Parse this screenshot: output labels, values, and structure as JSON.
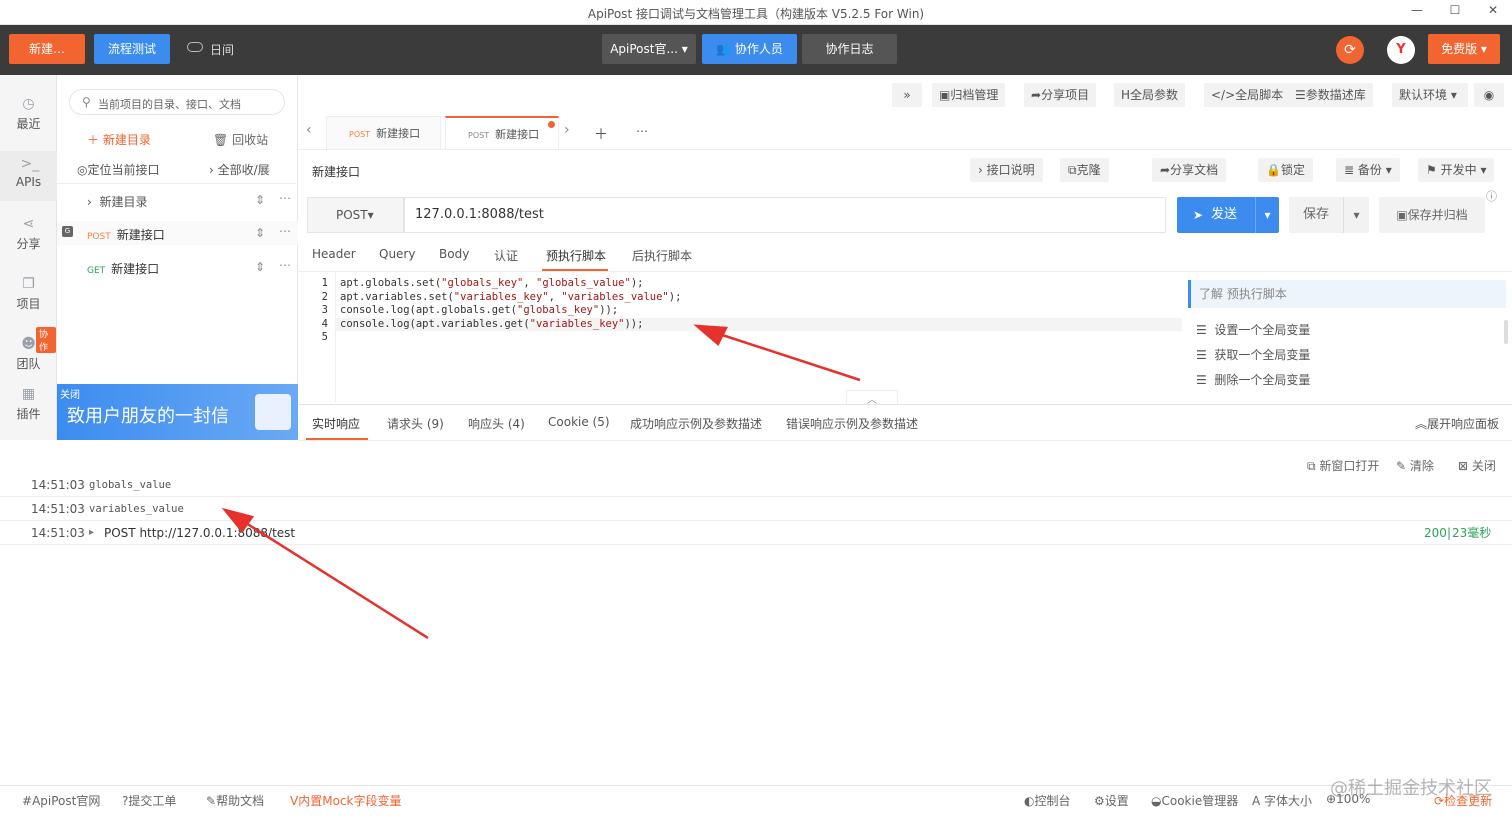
{
  "window": {
    "title": "ApiPost 接口调试与文档管理工具（构建版本 V5.2.5 For Win)",
    "min": "—",
    "max": "☐",
    "close": "✕"
  },
  "topbar": {
    "new_label": "新建…",
    "flow_label": "流程测试",
    "log_toggle": "日间",
    "project": "ApiPost官...",
    "collab": "协作人员",
    "collab_log": "协作日志",
    "plan": "免费版"
  },
  "sidebar": {
    "items": [
      {
        "label": "最近",
        "icon": "clock-icon",
        "glyph": "◷"
      },
      {
        "label": "APIs",
        "icon": "apis-icon",
        "glyph": ">_"
      },
      {
        "label": "分享",
        "icon": "share-icon",
        "glyph": "⋖"
      },
      {
        "label": "项目",
        "icon": "project-icon",
        "glyph": "❐"
      },
      {
        "label": "团队",
        "icon": "team-icon",
        "glyph": "☻",
        "badge": "协作"
      },
      {
        "label": "插件",
        "icon": "plugin-icon",
        "glyph": "▦"
      }
    ]
  },
  "tree": {
    "search_placeholder": "当前项目的目录、接口、文档",
    "new_folder": "新建目录",
    "trash": "回收站",
    "locate": "定位当前接口",
    "expand": "全部收/展",
    "items": [
      {
        "type": "folder",
        "name": "新建目录"
      },
      {
        "method": "POST",
        "name": "新建接口"
      },
      {
        "method": "GET",
        "name": "新建接口"
      }
    ],
    "banner_close": "关闭",
    "banner_text": "致用户朋友的一封信"
  },
  "toolbar": {
    "more": "»",
    "archive": "归档管理",
    "share_project": "分享项目",
    "global_params": "全局参数",
    "global_script": "全局脚本",
    "param_lib": "参数描述库",
    "env": "默认环境"
  },
  "tabs": [
    {
      "method": "POST",
      "name": "新建接口"
    },
    {
      "method": "POST",
      "name": "新建接口"
    }
  ],
  "request": {
    "title": "新建接口",
    "doc": "接口说明",
    "clone": "克隆",
    "share_doc": "分享文档",
    "lock": "锁定",
    "backup": "备份",
    "status": "开发中",
    "method": "POST",
    "url": "127.0.0.1:8088/test",
    "send": "发送",
    "save": "保存",
    "save_archive": "保存并归档",
    "subtabs": [
      "Header",
      "Query",
      "Body",
      "认证",
      "预执行脚本",
      "后执行脚本"
    ]
  },
  "code": {
    "lines": [
      [
        "apt.globals.set(",
        "\"globals_key\"",
        ", ",
        "\"globals_value\"",
        ");"
      ],
      [
        "apt.variables.set(",
        "\"variables_key\"",
        ", ",
        "\"variables_value\"",
        ");"
      ],
      [
        "console.log(apt.globals.get(",
        "\"globals_key\"",
        "));",
        "",
        ""
      ],
      [
        "console.log(apt.variables.get(",
        "\"variables_key\"",
        "));",
        "",
        ""
      ],
      [
        "",
        "",
        "",
        "",
        ""
      ]
    ]
  },
  "helper": {
    "title": "了解 预执行脚本",
    "items": [
      "设置一个全局变量",
      "获取一个全局变量",
      "删除一个全局变量"
    ]
  },
  "response": {
    "tabs": [
      "实时响应",
      "请求头 (9)",
      "响应头 (4)",
      "Cookie (5)",
      "成功响应示例及参数描述",
      "错误响应示例及参数描述"
    ],
    "expand": "展开响应面板",
    "new_window": "新窗口打开",
    "clear": "清除",
    "close": "关闭",
    "logs": [
      {
        "time": "14:51:03",
        "text": "globals_value"
      },
      {
        "time": "14:51:03",
        "text": "variables_value"
      },
      {
        "time": "14:51:03",
        "text": "POST  http://127.0.0.1:8088/test",
        "status": "200",
        "duration": "23毫秒"
      }
    ]
  },
  "footer": {
    "site": "ApiPost官网",
    "ticket": "提交工单",
    "help": "帮助文档",
    "mock": "内置Mock字段变量",
    "console": "控制台",
    "settings": "设置",
    "cookie": "Cookie管理器",
    "font": "字体大小",
    "zoom": "100%",
    "update": "检查更新",
    "watermark": "@稀土掘金技术社区"
  },
  "colors": {
    "accent": "#f26430",
    "blue": "#3c8cf0",
    "post": "#f5813b",
    "get": "#2ea35a",
    "arrow": "#e5322d"
  }
}
